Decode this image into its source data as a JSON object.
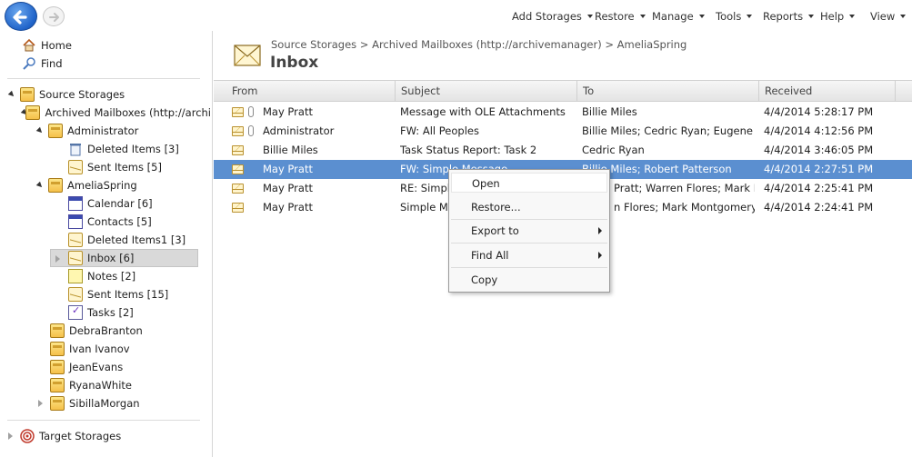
{
  "toolbar": {
    "menus": [
      {
        "label": "Add Storages"
      },
      {
        "label": "Restore"
      },
      {
        "label": "Manage"
      },
      {
        "label": "Tools"
      },
      {
        "label": "Reports"
      },
      {
        "label": "Help"
      },
      {
        "label": "View"
      }
    ]
  },
  "sidebar": {
    "home": "Home",
    "find": "Find",
    "source_storages": "Source Storages",
    "archived_mailboxes": "Archived Mailboxes (http://archi",
    "administrator": "Administrator",
    "admin_deleted": "Deleted Items  [3]",
    "admin_sent": "Sent Items  [5]",
    "amelia": "AmeliaSpring",
    "calendar": "Calendar  [6]",
    "contacts": "Contacts  [5]",
    "deleted1": "Deleted Items1  [3]",
    "inbox": "Inbox  [6]",
    "notes": "Notes  [2]",
    "sent": "Sent Items  [15]",
    "tasks": "Tasks  [2]",
    "debra": "DebraBranton",
    "ivan": "Ivan Ivanov",
    "jean": "JeanEvans",
    "ryana": "RyanaWhite",
    "sibilla": "SibillaMorgan",
    "target_storages": "Target Storages"
  },
  "header": {
    "breadcrumb": "Source Storages  >  Archived Mailboxes (http://archivemanager)  >  AmeliaSpring",
    "title": "Inbox"
  },
  "grid": {
    "columns": {
      "from": "From",
      "subject": "Subject",
      "to": "To",
      "received": "Received"
    },
    "rows": [
      {
        "from": "May Pratt",
        "subject": "Message with OLE Attachments",
        "to": "Billie Miles",
        "received": "4/4/2014 5:28:17 PM"
      },
      {
        "from": "Administrator",
        "subject": "FW: All Peoples",
        "to": "Billie Miles; Cedric Ryan; Eugene Tur...",
        "received": "4/4/2014 4:12:56 PM"
      },
      {
        "from": "Billie Miles",
        "subject": "Task Status Report: Task 2",
        "to": "Cedric Ryan",
        "received": "4/4/2014 3:46:05 PM"
      },
      {
        "from": "May Pratt",
        "subject": "FW: Simple Message",
        "to": "Billie Miles; Robert Patterson",
        "received": "4/4/2014 2:27:51 PM"
      },
      {
        "from": "May Pratt",
        "subject": "RE: Simple",
        "to": "Pratt; Warren Flores; Mark Mont...",
        "received": "4/4/2014 2:25:41 PM"
      },
      {
        "from": "May Pratt",
        "subject": "Simple Me",
        "to": "n Flores; Mark Montgomery; M...",
        "received": "4/4/2014 2:24:41 PM"
      }
    ]
  },
  "context_menu": {
    "open": "Open",
    "restore": "Restore...",
    "export_to": "Export to",
    "find_all": "Find All",
    "copy": "Copy"
  }
}
